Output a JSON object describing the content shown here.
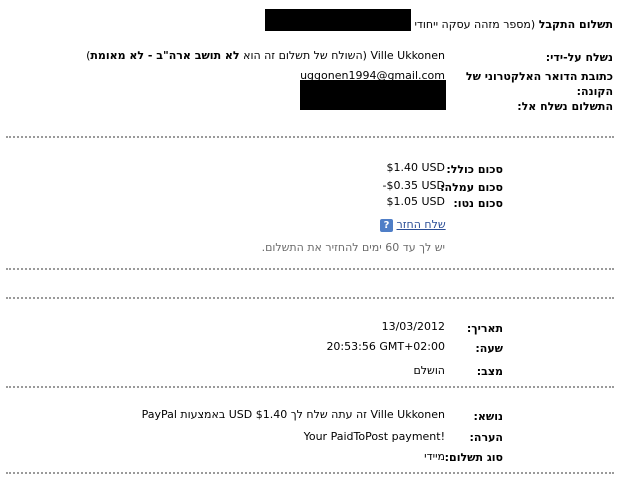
{
  "header": {
    "title": "תשלום התקבל",
    "transaction_note": "(מספר מזהה עסקה ייחודי"
  },
  "sender": {
    "sent_by_label": "נשלח על-ידי:",
    "sender_name": "Ville Ukkonen",
    "sender_note_prefix": "(השולח של תשלום זה הוא ",
    "sender_note_bold": "לא תושב ארה\"ב - לא מאומת",
    "sender_note_suffix": ")",
    "email_label": "כתובת הדואר האלקטרוני של",
    "email_label_2": "הקונה:",
    "email_value": "uggonen1994@gmail.com",
    "sent_to_label": "התשלום נשלח אל:"
  },
  "amounts": {
    "total_label": "סכום כולל:",
    "total_value": "$1.40 USD",
    "fee_label": "סכום עמלה:",
    "fee_value": "-$0.35 USD",
    "net_label": "סכום נטו:",
    "net_value": "$1.05 USD",
    "refund_link": "שלח החזר",
    "help_icon_glyph": "?",
    "refund_note": "יש לך עד 60 ימים להחזיר את התשלום."
  },
  "details": {
    "date_label": "תאריך:",
    "date_value": "13/03/2012",
    "time_label": "שעה:",
    "time_value": "20:53:56 GMT+02:00",
    "status_label": "מצב:",
    "status_value": "הושלם"
  },
  "message": {
    "subject_label": "נושא:",
    "subject_value": "Ville Ukkonen זה עתה שלח לך $1.40 USD באמצעות PayPal",
    "note_label": "הערה:",
    "note_value": "Your PaidToPost payment!",
    "type_label": "סוג תשלום:",
    "type_value": "מיידי"
  }
}
